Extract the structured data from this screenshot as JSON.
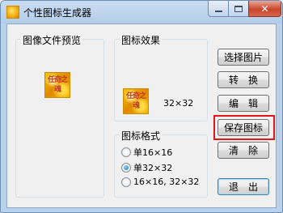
{
  "window": {
    "title": "个性图标生成器",
    "minimize_glyph": "",
    "close_glyph": "✕"
  },
  "preview_group": {
    "label": "图像文件预览"
  },
  "effect_group": {
    "label": "图标效果",
    "size_text": "32×32",
    "icon_text": "任奇之魂"
  },
  "format_group": {
    "label": "图标格式",
    "options": [
      {
        "label": "单16×16",
        "checked": false
      },
      {
        "label": "单32×32",
        "checked": true
      },
      {
        "label": "16×16, 32×32",
        "checked": false
      }
    ]
  },
  "buttons": {
    "select_image": "选择图片",
    "convert": "转　换",
    "edit": "编　辑",
    "save_icon": "保存图标",
    "clear": "清　除",
    "exit": "退　出"
  },
  "colors": {
    "highlight": "#e0161c",
    "title_bar": "#b9d1ea"
  }
}
